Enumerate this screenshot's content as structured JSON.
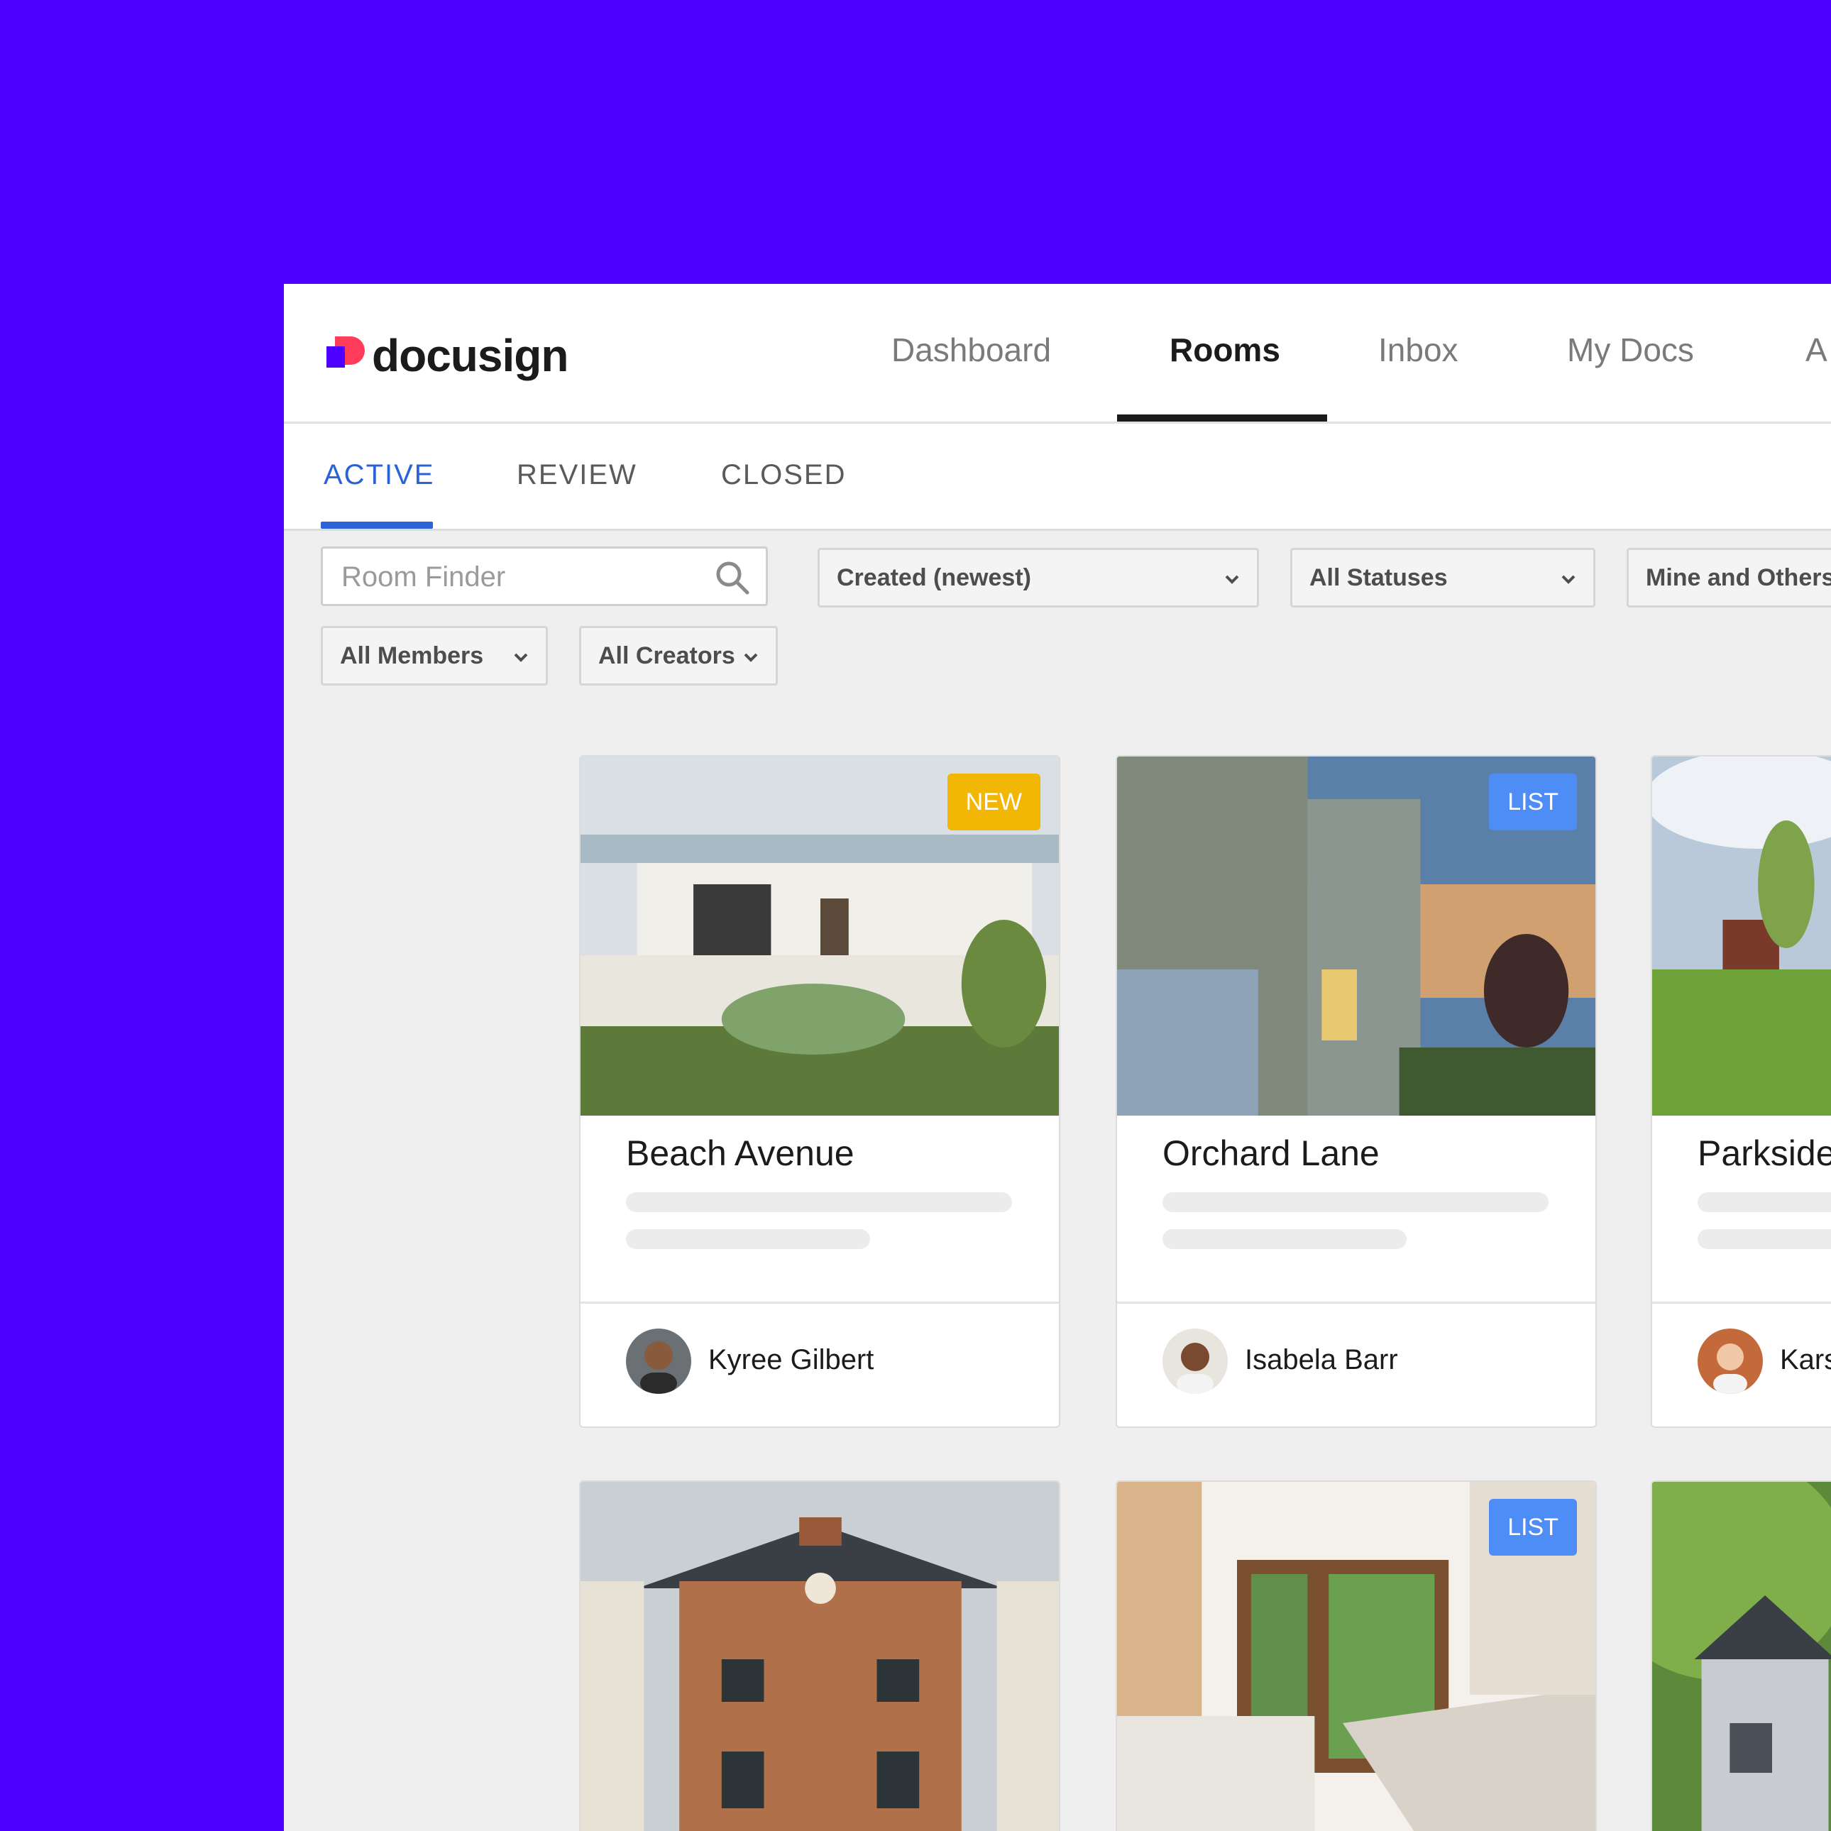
{
  "brand": {
    "name": "docusign"
  },
  "nav": {
    "items": [
      {
        "label": "Dashboard",
        "active": false
      },
      {
        "label": "Rooms",
        "active": true
      },
      {
        "label": "Inbox",
        "active": false
      },
      {
        "label": "My Docs",
        "active": false
      },
      {
        "label": "A",
        "active": false
      }
    ]
  },
  "subtabs": [
    {
      "label": "ACTIVE",
      "active": true
    },
    {
      "label": "REVIEW",
      "active": false
    },
    {
      "label": "CLOSED",
      "active": false
    }
  ],
  "filters": {
    "search_placeholder": "Room Finder",
    "sort": "Created (newest)",
    "status": "All Statuses",
    "ownership": "Mine and Others",
    "members": "All Members",
    "creators": "All Creators"
  },
  "cards": [
    {
      "title": "Beach Avenue",
      "badge": "NEW",
      "owner": "Kyree Gilbert"
    },
    {
      "title": "Orchard Lane",
      "badge": "LIST",
      "owner": "Isabela Barr"
    },
    {
      "title": "Parkside",
      "badge": "",
      "owner": "Kars"
    },
    {
      "title": "",
      "badge": "",
      "owner": ""
    },
    {
      "title": "",
      "badge": "LIST",
      "owner": ""
    },
    {
      "title": "",
      "badge": "",
      "owner": ""
    }
  ],
  "colors": {
    "brand_purple": "#4c00ff",
    "active_tab_blue": "#2a63d8",
    "badge_new": "#f2b705",
    "badge_list": "#4e8cf6"
  }
}
